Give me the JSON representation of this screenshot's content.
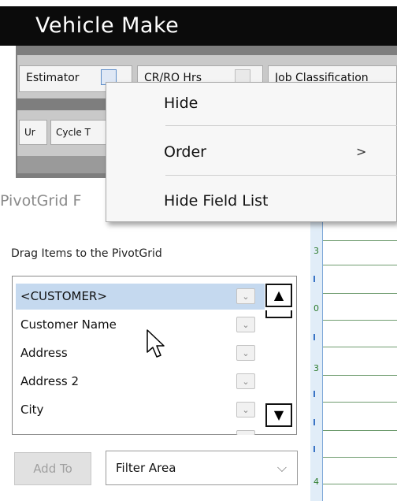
{
  "header": {
    "title": "Vehicle Make"
  },
  "field_chips": {
    "row1": [
      "Estimator",
      "CR/RO Hrs",
      "Job Classification"
    ],
    "row2": [
      "Ur",
      "Cycle T"
    ]
  },
  "pivot_panel": {
    "title": "PivotGrid F",
    "drag_hint": "Drag Items to the PivotGrid"
  },
  "field_list": {
    "items": [
      {
        "label": "<CUSTOMER>",
        "selected": true
      },
      {
        "label": "Customer Name",
        "selected": false
      },
      {
        "label": "Address",
        "selected": false
      },
      {
        "label": "Address 2",
        "selected": false
      },
      {
        "label": "City",
        "selected": false
      }
    ]
  },
  "controls": {
    "add_to_label": "Add To",
    "filter_selected": "Filter Area"
  },
  "context_menu": {
    "items": [
      {
        "label": "Hide",
        "has_submenu": false
      },
      {
        "label": "Order",
        "has_submenu": true
      },
      {
        "label": "Hide Field List",
        "has_submenu": false
      }
    ],
    "submenu_arrow": ">"
  },
  "grid_digits": [
    "3",
    "0",
    "3",
    "4"
  ],
  "colors": {
    "header_bg": "#0b0b0b",
    "selection": "#c5d9ef",
    "menu_bg": "#f7f7f7"
  },
  "icons": {
    "scroll_up": "triangle-up",
    "scroll_down": "triangle-down",
    "dropdown": "chevron-down",
    "cursor": "mouse-pointer-arrow"
  }
}
